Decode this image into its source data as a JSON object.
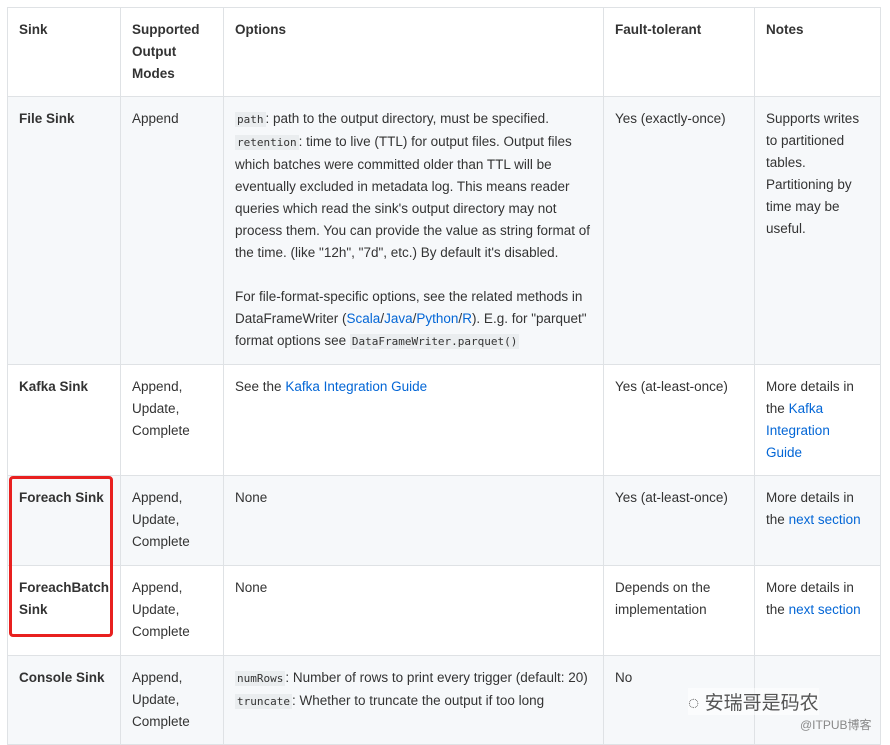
{
  "headers": [
    "Sink",
    "Supported Output Modes",
    "Options",
    "Fault-tolerant",
    "Notes"
  ],
  "rows": [
    {
      "sink": "File Sink",
      "modes": "Append",
      "opt": {
        "c1": "path",
        "t1": ": path to the output directory, must be specified.",
        "c2": "retention",
        "t2": ": time to live (TTL) for output files. Output files which batches were committed older than TTL will be eventually excluded in metadata log. This means reader queries which read the sink's output directory may not process them. You can provide the value as string format of the time. (like \"12h\", \"7d\", etc.) By default it's disabled.",
        "t3": "For file-format-specific options, see the related methods in DataFrameWriter (",
        "l1": "Scala",
        "l2": "Java",
        "l3": "Python",
        "l4": "R",
        "t4": "). E.g. for \"parquet\" format options see ",
        "c3": "DataFrameWriter.parquet()"
      },
      "fault": "Yes (exactly-once)",
      "notes": "Supports writes to partitioned tables. Partitioning by time may be useful."
    },
    {
      "sink": "Kafka Sink",
      "modes": "Append, Update, Complete",
      "opt_text": "See the ",
      "opt_link": "Kafka Integration Guide",
      "fault": "Yes (at-least-once)",
      "notes_text": "More details in the ",
      "notes_link": "Kafka Integration Guide"
    },
    {
      "sink": "Foreach Sink",
      "modes": "Append, Update, Complete",
      "opt": "None",
      "fault": "Yes (at-least-once)",
      "notes_text": "More details in the ",
      "notes_link": "next section"
    },
    {
      "sink": "ForeachBatch Sink",
      "modes": "Append, Update, Complete",
      "opt": "None",
      "fault": "Depends on the implementation",
      "notes_text": "More details in the ",
      "notes_link": "next section"
    },
    {
      "sink": "Console Sink",
      "modes": "Append, Update, Complete",
      "c1": "numRows",
      "t1": ": Number of rows to print every trigger (default: 20)",
      "c2": "truncate",
      "t2": ": Whether to truncate the output if too long",
      "fault": "No"
    }
  ],
  "watermark": {
    "name": "安瑞哥是码农",
    "source": "@ITPUB博客"
  },
  "colors": {
    "link": "#0366d6",
    "highlight": "#e8201f",
    "stripe": "#f6f8fa"
  }
}
